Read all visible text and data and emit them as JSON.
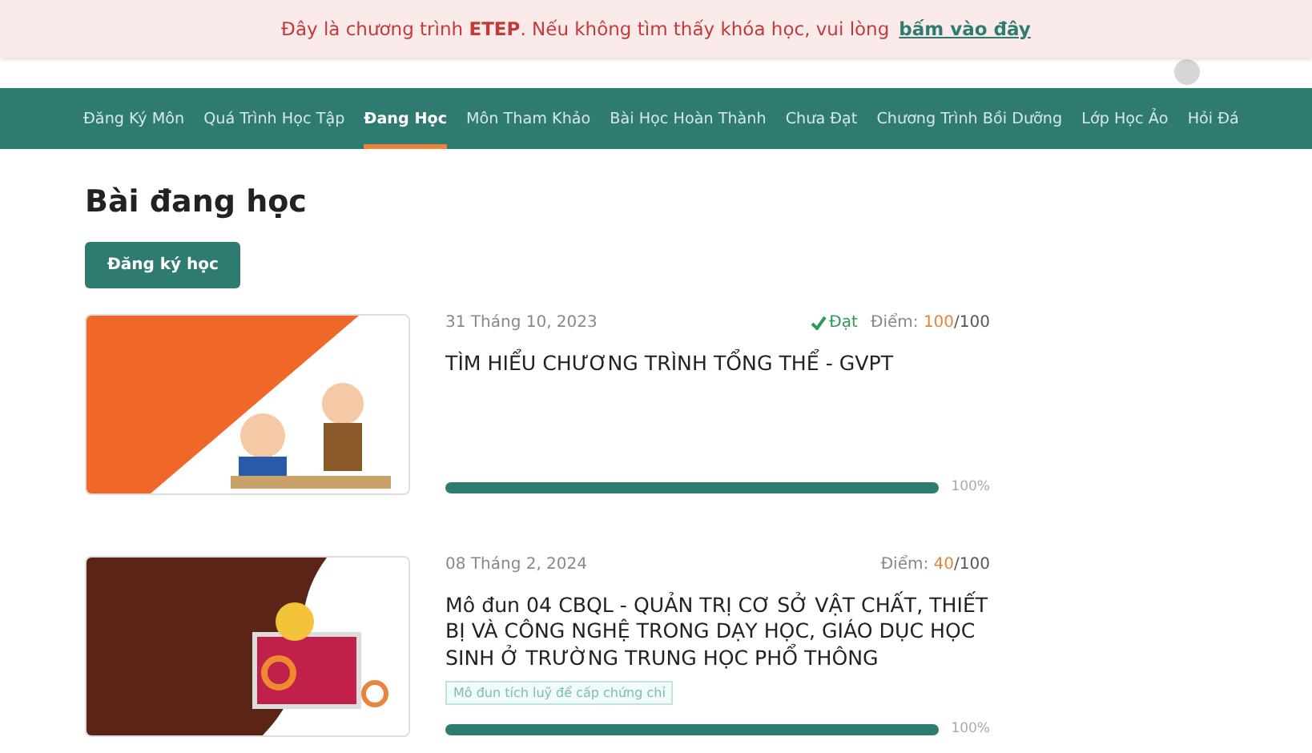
{
  "banner": {
    "text": "Đây là chương trình **ETEP**. Nếu không tìm thấy khóa học, vui lòng",
    "link": "bấm vào đây"
  },
  "nav": [
    {
      "label": "Đăng Ký Môn",
      "selected": false
    },
    {
      "label": "Quá Trình Học Tập",
      "selected": false
    },
    {
      "label": "Đang Học",
      "selected": true
    },
    {
      "label": "Môn Tham Khảo",
      "selected": false
    },
    {
      "label": "Bài Học Hoàn Thành",
      "selected": false
    },
    {
      "label": "Chưa Đạt",
      "selected": false
    },
    {
      "label": "Chương Trình Bồi Dưỡng",
      "selected": false
    },
    {
      "label": "Lớp Học Ảo",
      "selected": false
    },
    {
      "label": "Hỏi Đá",
      "selected": false
    }
  ],
  "page_title": "Bài đang học",
  "register_button": "Đăng ký học",
  "courses": [
    {
      "kind": "orange",
      "date": "31 Tháng 10, 2023",
      "passed": true,
      "pass_label": "Đạt",
      "score_label": "Điểm:",
      "score": "100",
      "max": "/100",
      "title": "TÌM HIỂU CHƯƠNG TRÌNH TỔNG THỂ - GVPT",
      "level": 1,
      "percent": "100%"
    },
    {
      "kind": "brown",
      "date": "08 Tháng 2, 2024",
      "passed": false,
      "score_label": "Điểm:",
      "score": "40",
      "max": "/100",
      "title": "Mô đun 04 CBQL - QUẢN TRỊ CƠ SỞ VẬT CHẤT, THIẾT BỊ VÀ CÔNG NGHỆ TRONG DẠY HỌC, GIÁO DỤC HỌC SINH Ở TRƯỜNG TRUNG HỌC PHỔ THÔNG",
      "tag": "Mô đun tích luỹ để cấp chứng chỉ",
      "level": 1,
      "percent": "100%"
    }
  ]
}
